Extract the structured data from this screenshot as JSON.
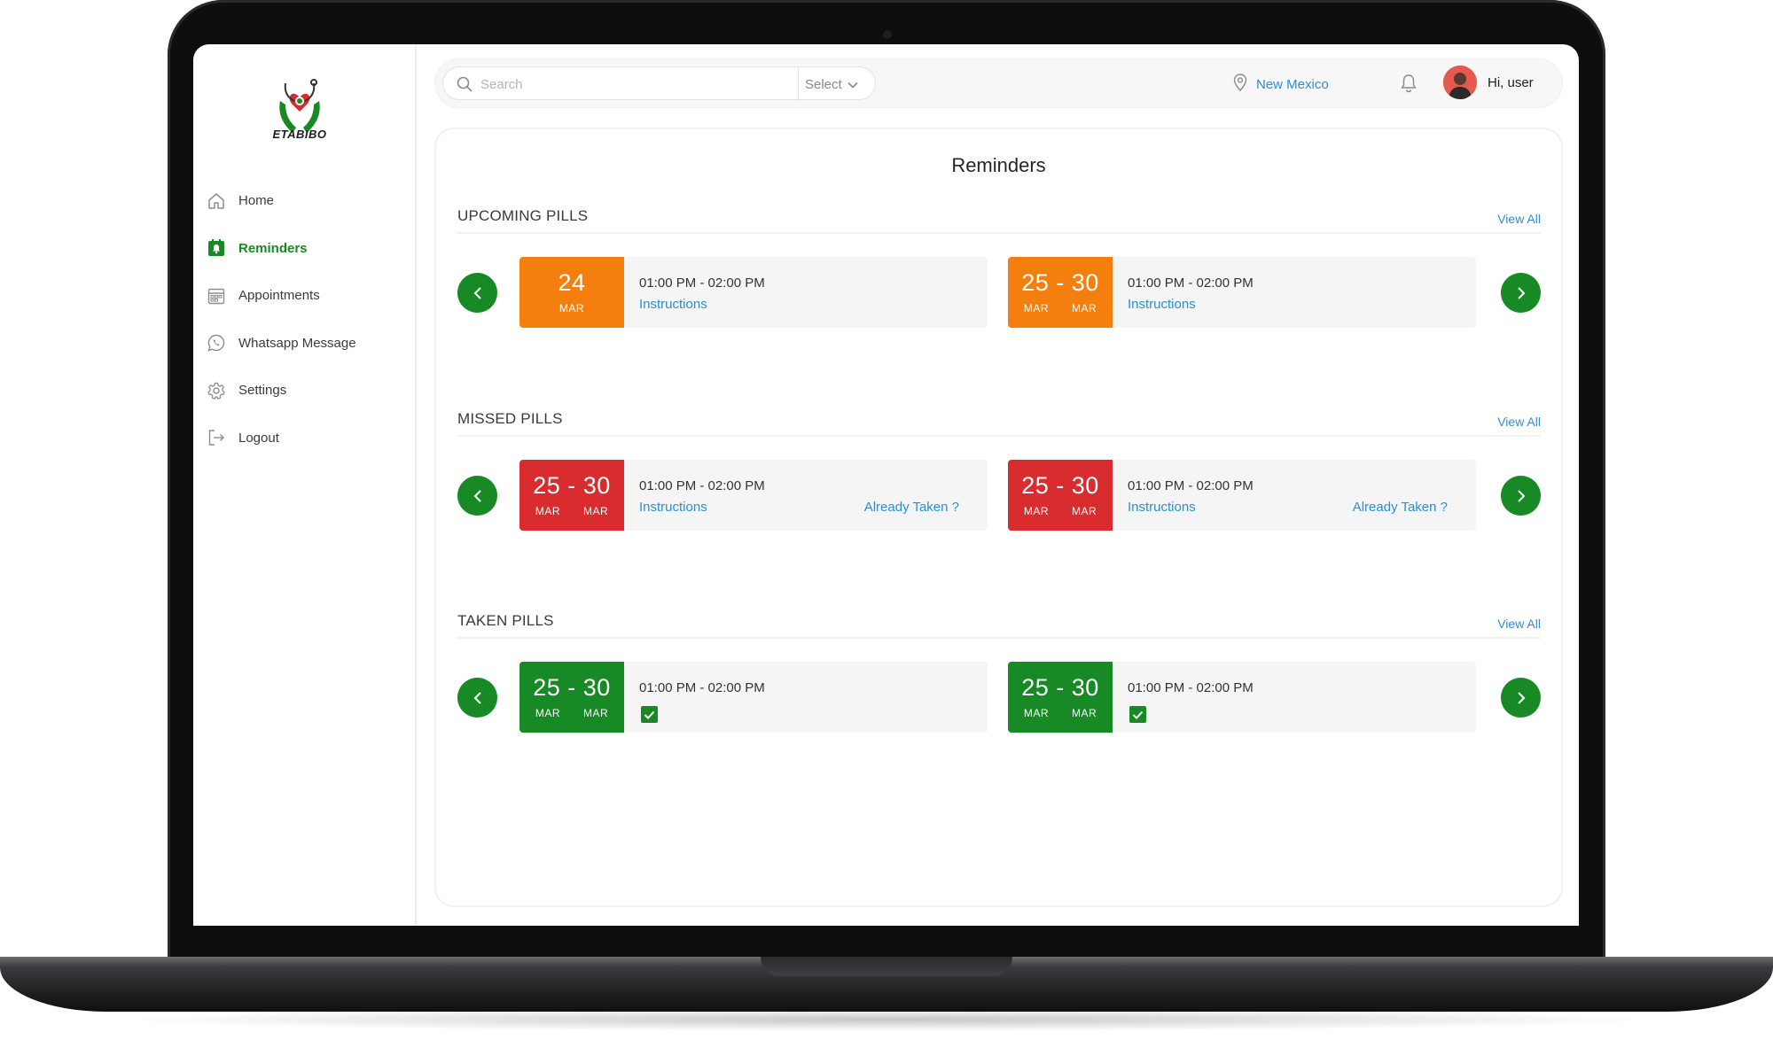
{
  "brand": {
    "name": "ETABIBO"
  },
  "sidebar": {
    "items": [
      {
        "label": "Home",
        "icon": "home-icon"
      },
      {
        "label": "Reminders",
        "icon": "reminder-icon",
        "active": true
      },
      {
        "label": "Appointments",
        "icon": "calendar-icon"
      },
      {
        "label": "Whatsapp Message",
        "icon": "whatsapp-icon"
      },
      {
        "label": "Settings",
        "icon": "gear-icon"
      },
      {
        "label": "Logout",
        "icon": "logout-icon"
      }
    ]
  },
  "header": {
    "search_placeholder": "Search",
    "select_label": "Select",
    "location": "New Mexico",
    "greeting": "Hi, user"
  },
  "page": {
    "title": "Reminders"
  },
  "sections": {
    "upcoming": {
      "title": "UPCOMING PILLS",
      "view_all": "View All",
      "cards": [
        {
          "date": "24",
          "months": [
            "MAR"
          ],
          "time": "01:00 PM - 02:00 PM",
          "link": "Instructions",
          "color": "#f57f0e"
        },
        {
          "date": "25 - 30",
          "months": [
            "MAR",
            "MAR"
          ],
          "time": "01:00 PM - 02:00 PM",
          "link": "Instructions",
          "color": "#f57f0e"
        }
      ]
    },
    "missed": {
      "title": "MISSED PILLS",
      "view_all": "View All",
      "cards": [
        {
          "date": "25 - 30",
          "months": [
            "MAR",
            "MAR"
          ],
          "time": "01:00 PM - 02:00 PM",
          "link": "Instructions",
          "action": "Already Taken ?",
          "color": "#d92c2f"
        },
        {
          "date": "25 - 30",
          "months": [
            "MAR",
            "MAR"
          ],
          "time": "01:00 PM - 02:00 PM",
          "link": "Instructions",
          "action": "Already Taken ?",
          "color": "#d92c2f"
        }
      ]
    },
    "taken": {
      "title": "TAKEN PILLS",
      "view_all": "View All",
      "cards": [
        {
          "date": "25 - 30",
          "months": [
            "MAR",
            "MAR"
          ],
          "time": "01:00 PM - 02:00 PM",
          "checked": true,
          "color": "#178a25"
        },
        {
          "date": "25 - 30",
          "months": [
            "MAR",
            "MAR"
          ],
          "time": "01:00 PM - 02:00 PM",
          "checked": true,
          "color": "#178a25"
        }
      ]
    }
  },
  "colors": {
    "accent_green": "#178a25",
    "upcoming_orange": "#f57f0e",
    "missed_red": "#d92c2f",
    "link_blue": "#2a8fd8"
  }
}
